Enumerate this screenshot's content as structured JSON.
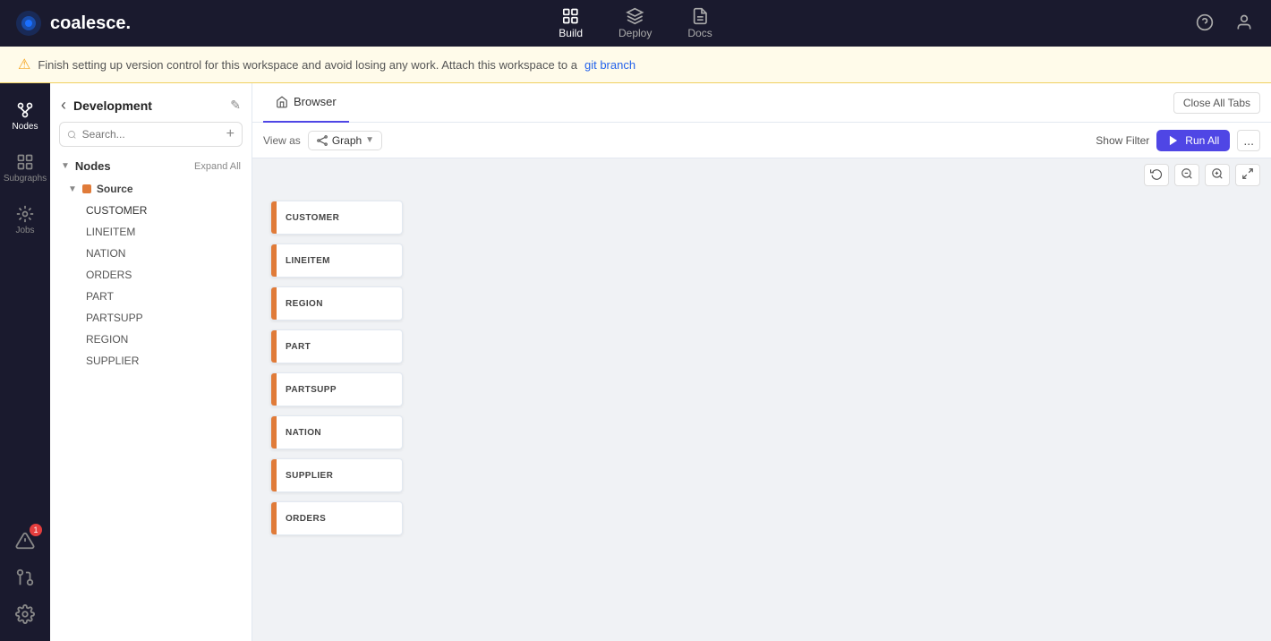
{
  "app": {
    "logo_text": "coalesce.",
    "warning_text": "Finish setting up version control for this workspace and avoid losing any work. Attach this workspace to a",
    "warning_link": "git branch"
  },
  "nav": {
    "items": [
      {
        "id": "build",
        "label": "Build",
        "active": true
      },
      {
        "id": "deploy",
        "label": "Deploy",
        "active": false
      },
      {
        "id": "docs",
        "label": "Docs",
        "active": false
      }
    ]
  },
  "sidebar": {
    "workspace_name": "Development",
    "search_placeholder": "Search...",
    "nodes_label": "Nodes",
    "expand_all_label": "Expand All",
    "source_group": "Source",
    "tree_items": [
      {
        "id": "customer",
        "label": "CUSTOMER"
      },
      {
        "id": "lineitem",
        "label": "LINEITEM"
      },
      {
        "id": "nation",
        "label": "NATION"
      },
      {
        "id": "orders",
        "label": "ORDERS"
      },
      {
        "id": "part",
        "label": "PART"
      },
      {
        "id": "partsupp",
        "label": "PARTSUPP"
      },
      {
        "id": "region",
        "label": "REGION"
      },
      {
        "id": "supplier",
        "label": "SUPPLIER"
      }
    ]
  },
  "icon_nav": {
    "items": [
      {
        "id": "nodes",
        "label": "Nodes",
        "active": true
      },
      {
        "id": "subgraphs",
        "label": "Subgraphs",
        "active": false
      },
      {
        "id": "jobs",
        "label": "Jobs",
        "active": false
      }
    ],
    "bottom": [
      {
        "id": "alerts",
        "label": "",
        "badge": "1"
      },
      {
        "id": "git",
        "label": ""
      },
      {
        "id": "settings",
        "label": ""
      }
    ]
  },
  "tabs": {
    "items": [
      {
        "id": "browser",
        "label": "Browser",
        "active": true
      }
    ],
    "close_all_label": "Close All Tabs"
  },
  "toolbar": {
    "view_as_label": "View as",
    "graph_label": "Graph",
    "show_filter_label": "Show Filter",
    "run_all_label": "Run All",
    "more_label": "..."
  },
  "graph": {
    "nodes": [
      {
        "id": "customer",
        "label": "CUSTOMER"
      },
      {
        "id": "lineitem",
        "label": "LINEITEM"
      },
      {
        "id": "region",
        "label": "REGION"
      },
      {
        "id": "part",
        "label": "PART"
      },
      {
        "id": "partsupp",
        "label": "PARTSUPP"
      },
      {
        "id": "nation",
        "label": "NATION"
      },
      {
        "id": "supplier",
        "label": "SUPPLIER"
      },
      {
        "id": "orders",
        "label": "ORDERS"
      }
    ]
  },
  "colors": {
    "accent": "#e07b39",
    "nav_bg": "#1a1a2e",
    "run_btn": "#4f46e5"
  }
}
